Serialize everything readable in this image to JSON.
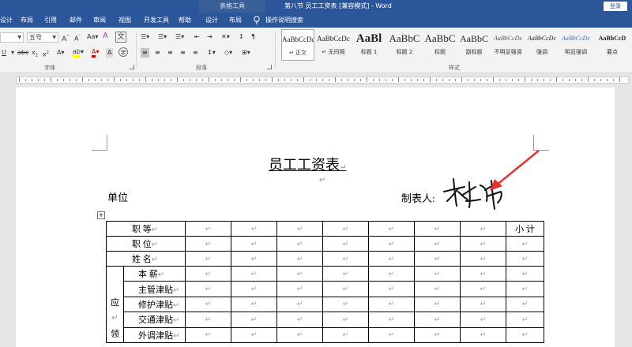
{
  "titlebar": {
    "context_tab": "表格工具",
    "title": "第八节 员工工资表 [兼容模式] - Word",
    "login": "登录"
  },
  "tabs": [
    "设计",
    "布局",
    "引用",
    "邮件",
    "审阅",
    "视图",
    "开发工具",
    "帮助",
    "设计",
    "布局"
  ],
  "tell_me": "操作说明搜索",
  "ribbon": {
    "font_name": "",
    "font_size": "五号",
    "groups": {
      "font": "字体",
      "paragraph": "段落",
      "styles": "样式"
    },
    "styles": [
      {
        "preview": "AaBbCcDc",
        "name": "↵ 正文"
      },
      {
        "preview": "AaBbCcDc",
        "name": "↵ 无间隔"
      },
      {
        "preview": "AaBl",
        "name": "标题 1"
      },
      {
        "preview": "AaBbC",
        "name": "标题 2"
      },
      {
        "preview": "AaBbC",
        "name": "标题"
      },
      {
        "preview": "AaBbC",
        "name": "副标题"
      },
      {
        "preview": "AaBbCcDc",
        "name": "不明显强调"
      },
      {
        "preview": "AaBbCcDc",
        "name": "强调"
      },
      {
        "preview": "AaBbCcDc",
        "name": "明显强调"
      },
      {
        "preview": "AaBbCcD",
        "name": "要点"
      }
    ]
  },
  "document": {
    "title": "员工工资表",
    "para_mark": "↵",
    "unit_label": "单位",
    "maker_label": "制表人:",
    "table": {
      "header_rows": [
        {
          "label": "职 等",
          "last": "小 计"
        },
        {
          "label": "职 位",
          "last": ""
        },
        {
          "label": "姓 名",
          "last": ""
        }
      ],
      "group_label_top": "应",
      "group_label_mid": "↵",
      "group_label_bottom": "领",
      "sub_rows": [
        "本 薪",
        "主管津贴",
        "修护津贴",
        "交通津贴",
        "外调津贴"
      ]
    }
  }
}
